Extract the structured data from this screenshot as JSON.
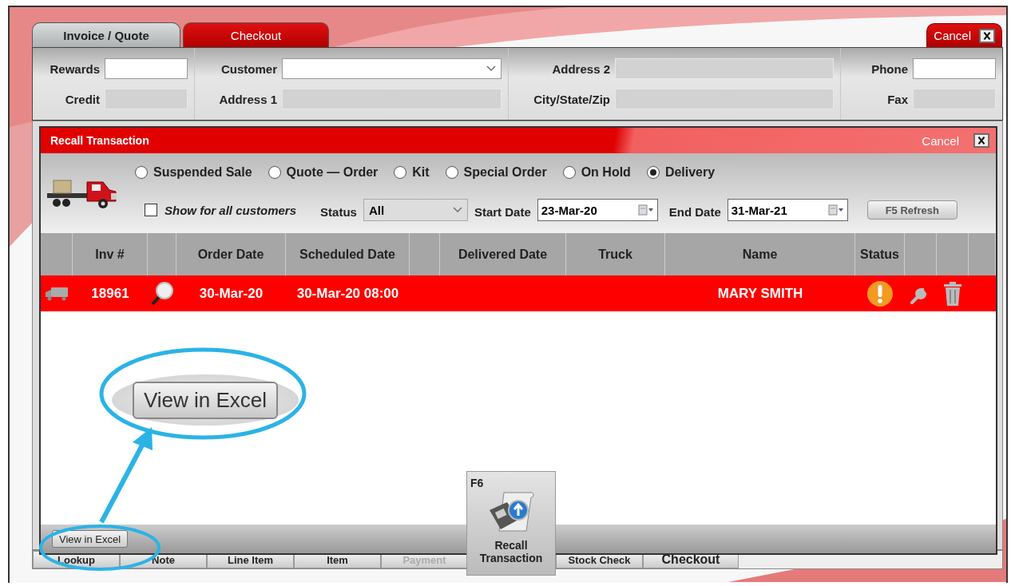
{
  "tabs": [
    {
      "label": "Invoice / Quote",
      "selected": true
    },
    {
      "label": "Checkout",
      "selected": false
    }
  ],
  "cancel_button": {
    "label": "Cancel"
  },
  "field_groups": [
    {
      "fields": [
        {
          "label": "Rewards",
          "kind": "text"
        },
        {
          "label": "Credit",
          "kind": "readonly"
        }
      ]
    },
    {
      "fields": [
        {
          "label": "Customer",
          "kind": "select"
        },
        {
          "label": "Address 1",
          "kind": "readonly"
        }
      ]
    },
    {
      "fields": [
        {
          "label": "Address 2",
          "kind": "readonly"
        },
        {
          "label": "City/State/Zip",
          "kind": "readonly"
        }
      ]
    },
    {
      "fields": [
        {
          "label": "Phone",
          "kind": "text"
        },
        {
          "label": "Fax",
          "kind": "readonly"
        }
      ]
    }
  ],
  "dialog": {
    "title": "Recall Transaction",
    "cancel": "Cancel",
    "types": [
      {
        "label": "Suspended Sale",
        "selected": false
      },
      {
        "label": "Quote — Order",
        "selected": false
      },
      {
        "label": "Kit",
        "selected": false
      },
      {
        "label": "Special Order",
        "selected": false
      },
      {
        "label": "On Hold",
        "selected": false
      },
      {
        "label": "Delivery",
        "selected": true
      }
    ],
    "show_all": {
      "label": "Show for all customers",
      "checked": false
    },
    "status": {
      "label": "Status",
      "value": "All"
    },
    "start_date": {
      "label": "Start Date",
      "value": "23-Mar-20"
    },
    "end_date": {
      "label": "End Date",
      "value": "31-Mar-21"
    },
    "refresh": "F5 Refresh",
    "columns": [
      {
        "kind": "blank"
      },
      {
        "kind": "text",
        "label": "Inv #"
      },
      {
        "kind": "blank"
      },
      {
        "kind": "text",
        "label": "Order Date"
      },
      {
        "kind": "text",
        "label": "Scheduled Date"
      },
      {
        "kind": "blank"
      },
      {
        "kind": "text",
        "label": "Delivered Date"
      },
      {
        "kind": "text",
        "label": "Truck"
      },
      {
        "kind": "text",
        "label": "Name"
      },
      {
        "kind": "text",
        "label": "Status"
      },
      {
        "kind": "blank"
      },
      {
        "kind": "blank"
      },
      {
        "kind": "blank"
      }
    ],
    "rows": [
      {
        "selected": true,
        "inv": "18961",
        "order_date": "30-Mar-20",
        "scheduled_date": "30-Mar-20 08:00",
        "name": "MARY SMITH"
      }
    ],
    "footer_button": "View in Excel"
  },
  "bottom_buttons": [
    {
      "label": "Lookup",
      "disabled": false
    },
    {
      "label": "Note",
      "disabled": false
    },
    {
      "label": "Line Item",
      "disabled": false
    },
    {
      "label": "Item",
      "disabled": false
    },
    {
      "label": "Payment",
      "disabled": true
    },
    {
      "label": "Stock Check",
      "disabled": false
    },
    {
      "label": "Checkout",
      "disabled": false
    }
  ],
  "callout": {
    "text": "View in Excel"
  },
  "hotkey_tile": {
    "key": "F6",
    "label": "Recall Transaction"
  }
}
